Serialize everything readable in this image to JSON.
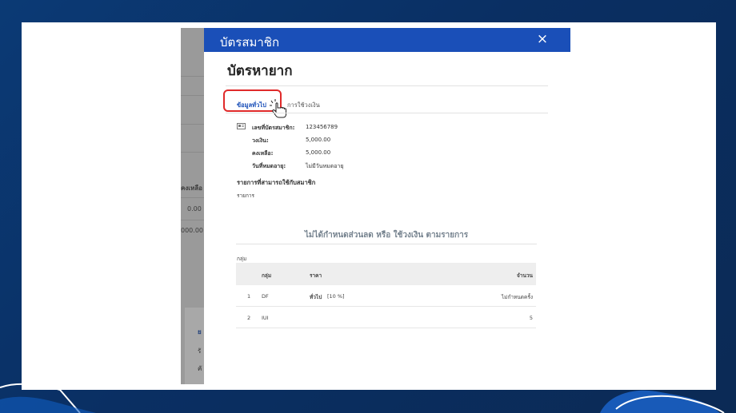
{
  "backdrop": {
    "header_text": "คงเหลือ",
    "values": [
      "0.00",
      "000.00"
    ],
    "side_letters": [
      "ย",
      "รั",
      "คั"
    ]
  },
  "modal": {
    "title": "บัตรสมาชิก",
    "close_label": "×",
    "card_name": "บัตรหายาก",
    "tabs": [
      {
        "label": "ข้อมูลทั่วไป",
        "active": true
      },
      {
        "label": "การใช้วงเงิน",
        "active": false
      }
    ],
    "info": {
      "member_card_label": "เลขที่บัตรสมาชิก:",
      "member_card_value": "123456789",
      "limit_label": "วงเงิน:",
      "limit_value": "5,000.00",
      "remaining_label": "คงเหลือ:",
      "remaining_value": "5,000.00",
      "expiry_label": "วันที่หมดอายุ:",
      "expiry_value": "ไม่มีวันหมดอายุ"
    },
    "section_title": "รายการที่สามารถใช้กับสมาชิก",
    "section_sub": "รายการ",
    "notice": "ไม่ได้กำหนดส่วนลด หรือ ใช้วงเงิน ตามรายการ",
    "group_label": "กลุ่ม",
    "table": {
      "headers": {
        "group": "กลุ่ม",
        "price": "ราคา",
        "amount": "จำนวน"
      },
      "rows": [
        {
          "no": "1",
          "group": "DF",
          "price_type": "ทั่วไป",
          "price_detail": "[10 %]",
          "amount": "ไม่กำหนดครั้ง"
        },
        {
          "no": "2",
          "group": "IUI",
          "price_type": "",
          "price_detail": "",
          "amount": "5"
        }
      ]
    }
  },
  "colors": {
    "header_blue": "#1a4fb8",
    "highlight_red": "#e02a2a",
    "background_navy": "#0b3a75"
  }
}
